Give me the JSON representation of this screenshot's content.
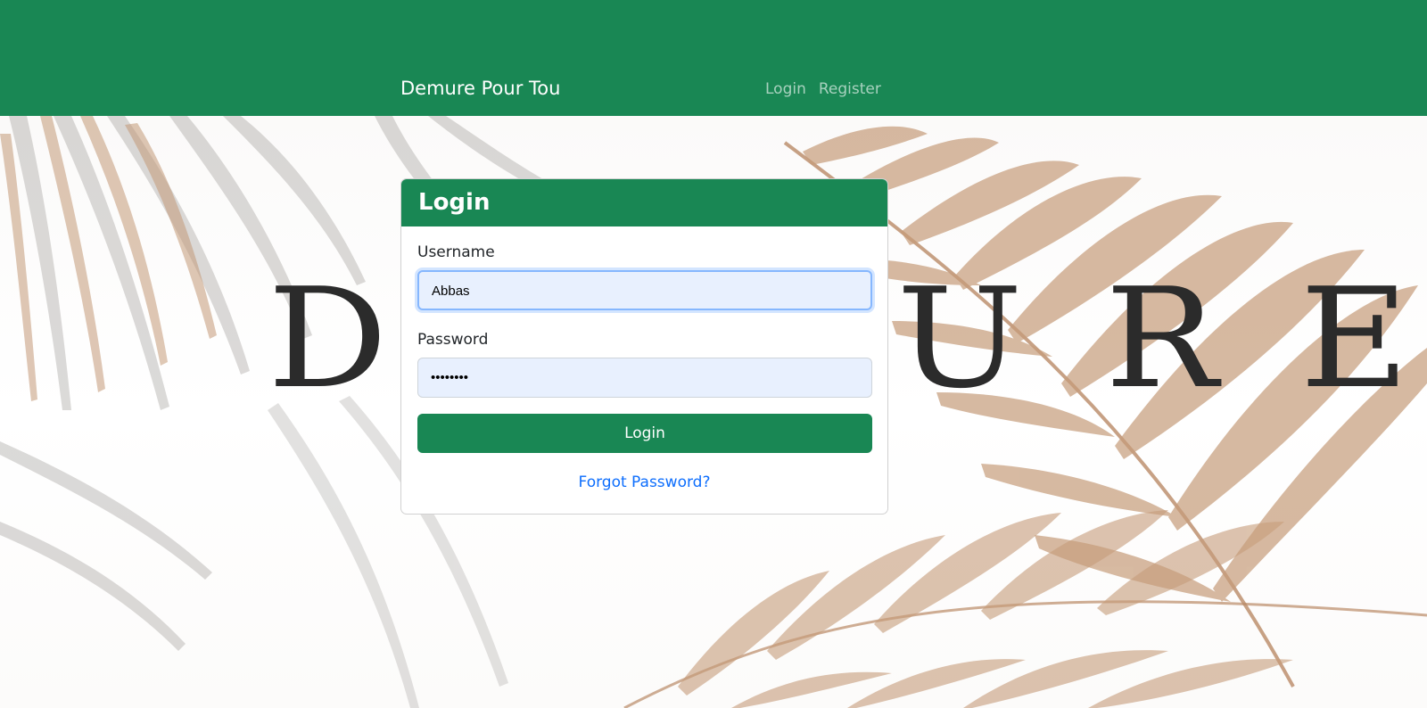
{
  "navbar": {
    "brand": "Demure Pour Tou",
    "links": [
      {
        "label": "Login"
      },
      {
        "label": "Register"
      }
    ]
  },
  "hero": {
    "word": "DEMURE"
  },
  "login_card": {
    "title": "Login",
    "username": {
      "label": "Username",
      "value": "Abbas"
    },
    "password": {
      "label": "Password",
      "value": "••••••••"
    },
    "submit_label": "Login",
    "forgot_label": "Forgot Password?"
  },
  "colors": {
    "primary": "#198754",
    "link": "#0d6efd",
    "input_autofill": "#e8f0fe",
    "focus_ring": "#86b7fe"
  }
}
